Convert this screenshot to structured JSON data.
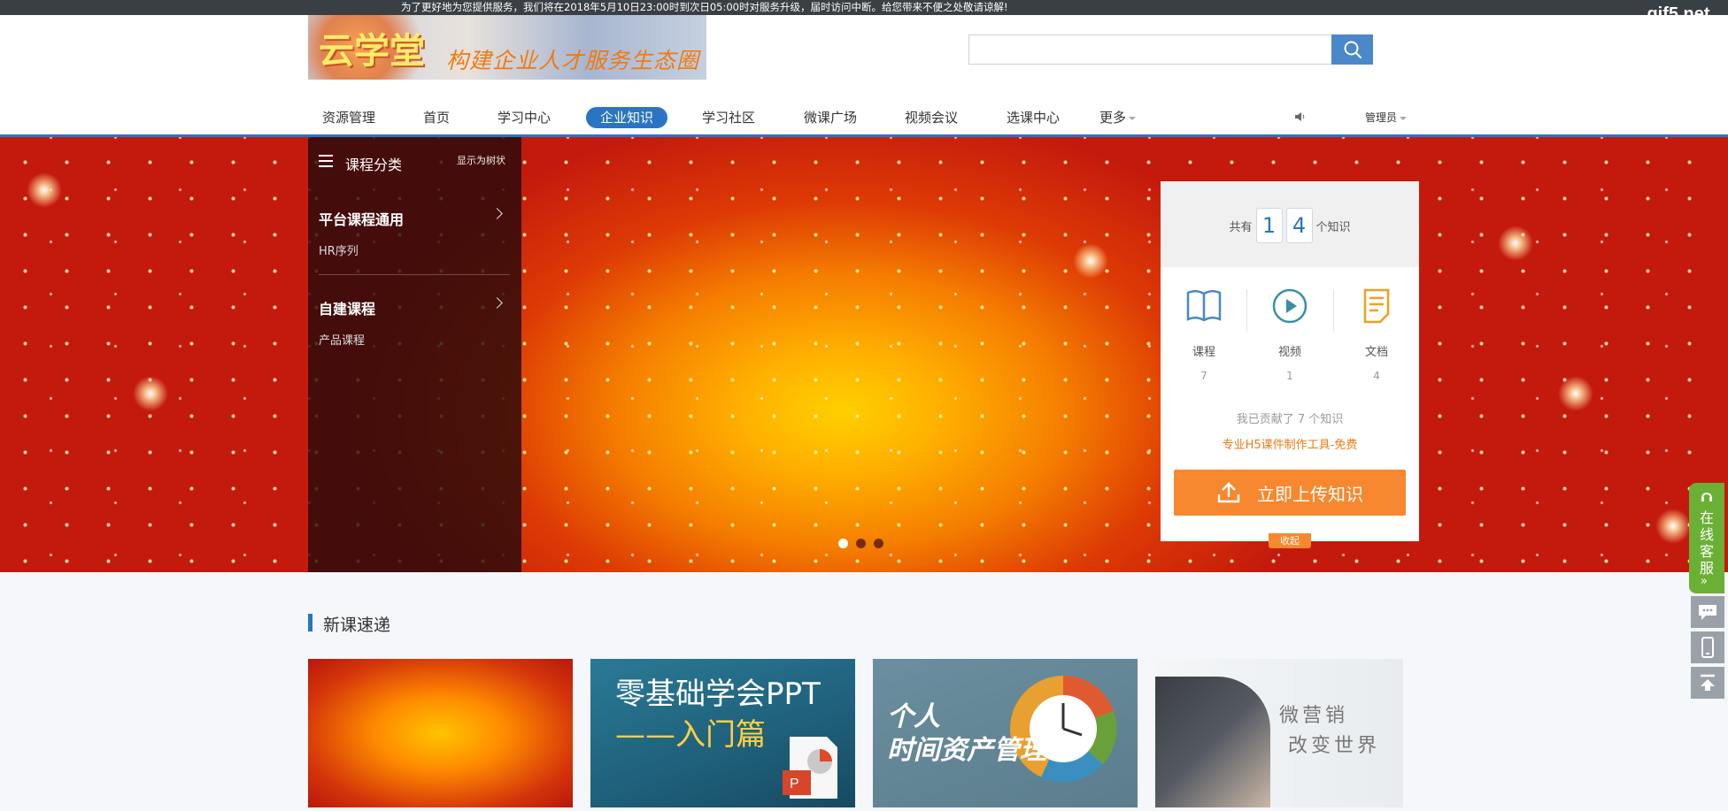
{
  "notice": "为了更好地为您提供服务，我们将在2018年5月10日23:00时到次日05:00时对服务升级，届时访问中断。给您带来不便之处敬请谅解!",
  "watermark": "gif5.net",
  "logo": {
    "name": "云学堂",
    "slogan": "构建企业人才服务生态圈"
  },
  "search": {
    "placeholder": "",
    "icon": "search-icon"
  },
  "nav": {
    "items": [
      {
        "label": "资源管理"
      },
      {
        "label": "首页"
      },
      {
        "label": "学习中心"
      },
      {
        "label": "企业知识",
        "active": true
      },
      {
        "label": "学习社区"
      },
      {
        "label": "微课广场"
      },
      {
        "label": "视频会议"
      },
      {
        "label": "选课中心"
      },
      {
        "label": "更多"
      }
    ],
    "sound_icon": "speaker-icon",
    "user": "管理员"
  },
  "category": {
    "title": "课程分类",
    "tree_toggle": "显示为树状",
    "groups": [
      {
        "title": "平台课程通用",
        "sub": "HR序列"
      },
      {
        "title": "自建课程",
        "sub": "产品课程"
      }
    ]
  },
  "carousel": {
    "slides": 3,
    "active": 1
  },
  "stats": {
    "prefix": "共有",
    "digits": [
      "1",
      "4"
    ],
    "suffix": "个知识",
    "items": [
      {
        "label": "课程",
        "value": "7",
        "icon": "book-icon"
      },
      {
        "label": "视频",
        "value": "1",
        "icon": "play-icon"
      },
      {
        "label": "文档",
        "value": "4",
        "icon": "document-icon"
      }
    ],
    "contributed": "我已贡献了 7 个知识",
    "h5_link": "专业H5课件制作工具-免费",
    "upload_label": "立即上传知识",
    "collapse_label": "收起"
  },
  "section": {
    "title": "新课速递"
  },
  "courses": [
    {
      "line1": "",
      "line2": ""
    },
    {
      "line1": "零基础学会PPT",
      "line2": "——入门篇"
    },
    {
      "line1": "个人",
      "line2": "时间资产管理"
    },
    {
      "line1": "微营销",
      "line2": "改变世界"
    }
  ],
  "sidebar": {
    "service": "在线客服",
    "tools": [
      "chat-icon",
      "mobile-icon",
      "back-to-top-icon"
    ]
  },
  "colors": {
    "primary": "#2a74c3",
    "accent": "#f7882f",
    "service": "#6ab035"
  }
}
